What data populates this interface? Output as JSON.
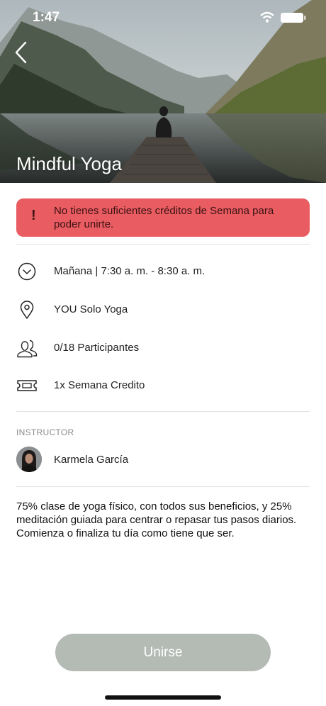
{
  "status_bar": {
    "time": "1:47"
  },
  "hero": {
    "title": "Mindful Yoga"
  },
  "alert": {
    "icon_text": "!",
    "message": "No tienes suficientes créditos de Semana para poder unirte.",
    "color": "#e95c61"
  },
  "details": [
    {
      "icon": "clock-icon",
      "text": "Mañana | 7:30 a. m. - 8:30 a. m."
    },
    {
      "icon": "location-pin-icon",
      "text": "YOU Solo Yoga"
    },
    {
      "icon": "participants-icon",
      "text": "0/18 Participantes"
    },
    {
      "icon": "ticket-icon",
      "text": "1x Semana Credito"
    }
  ],
  "instructor": {
    "section_label": "INSTRUCTOR",
    "name": "Karmela García"
  },
  "description": "75% clase de yoga físico, con todos sus beneficios, y 25% meditación guiada para centrar o repasar tus pasos diarios. Comienza o finaliza tu día como tiene que ser.",
  "join_button": {
    "label": "Unirse",
    "color": "#b4bbb5"
  }
}
